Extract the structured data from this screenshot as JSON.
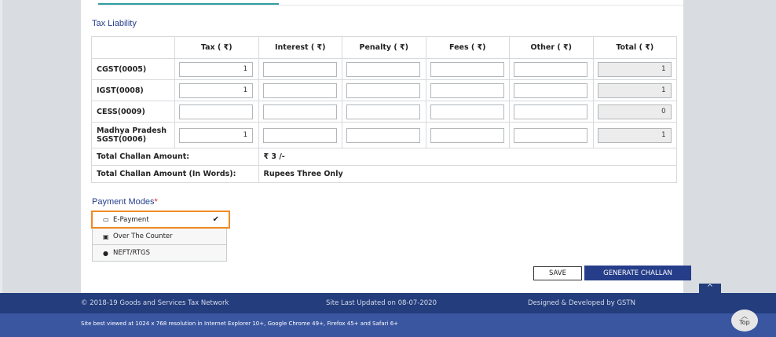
{
  "section_title": "Tax Liability",
  "table": {
    "headers": [
      "Tax ( ₹)",
      "Interest ( ₹)",
      "Penalty ( ₹)",
      "Fees ( ₹)",
      "Other ( ₹)",
      "Total ( ₹)"
    ],
    "rows": [
      {
        "name": "CGST(0005)",
        "values": [
          "1",
          "",
          "",
          "",
          "",
          "1"
        ]
      },
      {
        "name": "IGST(0008)",
        "values": [
          "1",
          "",
          "",
          "",
          "",
          "1"
        ]
      },
      {
        "name": "CESS(0009)",
        "values": [
          "",
          "",
          "",
          "",
          "",
          "0"
        ]
      },
      {
        "name": "Madhya Pradesh SGST(0006)",
        "values": [
          "1",
          "",
          "",
          "",
          "",
          "1"
        ]
      }
    ],
    "total_amount_label": "Total Challan Amount:",
    "total_amount_value": "₹ 3 /-",
    "total_words_label": "Total Challan Amount (In Words):",
    "total_words_value": "Rupees Three Only"
  },
  "payment_modes": {
    "title": "Payment Modes",
    "required_mark": "*",
    "items": [
      {
        "label": "E-Payment",
        "icon": "credit-card-icon",
        "selected": true
      },
      {
        "label": "Over The Counter",
        "icon": "cash-icon",
        "selected": false
      },
      {
        "label": "NEFT/RTGS",
        "icon": "globe-icon",
        "selected": false
      }
    ],
    "check_mark": "✔"
  },
  "buttons": {
    "save": "SAVE",
    "generate": "GENERATE CHALLAN",
    "scroll_up": "^",
    "top": "Top"
  },
  "footer": {
    "copyright": "© 2018-19 Goods and Services Tax Network",
    "updated": "Site Last Updated on 08-07-2020",
    "designed": "Designed & Developed by GSTN",
    "best_viewed": "Site best viewed at 1024 x 768 resolution in Internet Explorer 10+, Google Chrome 49+, Firefox 45+ and Safari 6+"
  },
  "colors": {
    "accent": "#263e8a",
    "footer_dark": "#233d7d",
    "footer_light": "#3a56a0",
    "highlight": "#f08a24",
    "tab": "#2f9fa3"
  }
}
